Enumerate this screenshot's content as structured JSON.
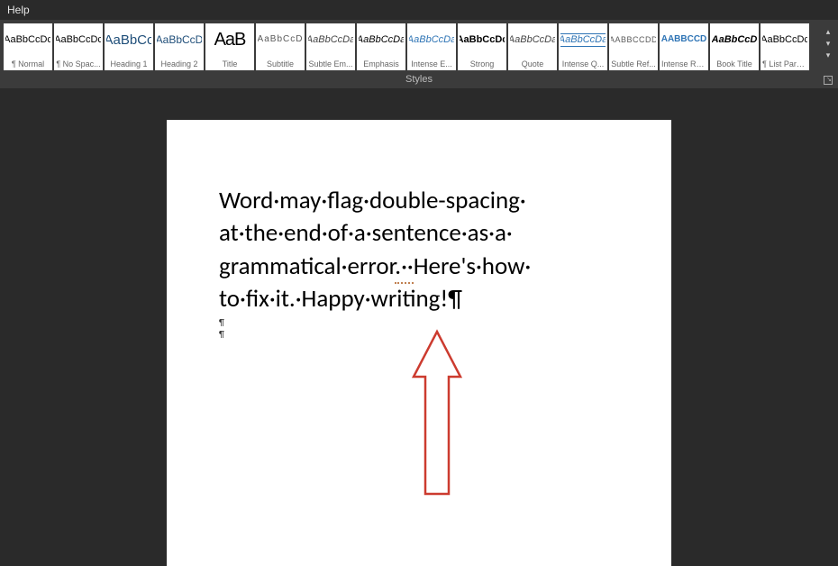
{
  "menu": {
    "help": "Help"
  },
  "styles": {
    "group_label": "Styles",
    "items": [
      {
        "sample": "AaBbCcDc",
        "label": "¶ Normal",
        "cls": "s-normal"
      },
      {
        "sample": "AaBbCcDc",
        "label": "¶ No Spac...",
        "cls": "s-normal"
      },
      {
        "sample": "AaBbCc",
        "label": "Heading 1",
        "cls": "s-heading1"
      },
      {
        "sample": "AaBbCcD",
        "label": "Heading 2",
        "cls": "s-heading2"
      },
      {
        "sample": "AaB",
        "label": "Title",
        "cls": "s-title"
      },
      {
        "sample": "AaBbCcD",
        "label": "Subtitle",
        "cls": "s-subtitle"
      },
      {
        "sample": "AaBbCcDa",
        "label": "Subtle Em...",
        "cls": "s-subtleem"
      },
      {
        "sample": "AaBbCcDa",
        "label": "Emphasis",
        "cls": "s-emphasis"
      },
      {
        "sample": "AaBbCcDa",
        "label": "Intense E...",
        "cls": "s-intensee"
      },
      {
        "sample": "AaBbCcDc",
        "label": "Strong",
        "cls": "s-strong"
      },
      {
        "sample": "AaBbCcDa",
        "label": "Quote",
        "cls": "s-quote"
      },
      {
        "sample": "AaBbCcDa",
        "label": "Intense Q...",
        "cls": "s-intenseq"
      },
      {
        "sample": "AABBCCDD",
        "label": "Subtle Ref...",
        "cls": "s-subtleref"
      },
      {
        "sample": "AABBCCD",
        "label": "Intense Re...",
        "cls": "s-intenseref"
      },
      {
        "sample": "AaBbCcD",
        "label": "Book Title",
        "cls": "s-booktitle"
      },
      {
        "sample": "AaBbCcDc",
        "label": "¶ List Para...",
        "cls": "s-listpara"
      }
    ]
  },
  "doc": {
    "line1": "Word·may·flag·double-spacing·",
    "line2": "at·the·end·of·a·sentence·as·a·",
    "line3a": "grammatical·error",
    "line3err": ".··",
    "line3b": "Here's·how·",
    "line4": "to·fix·it.·Happy·writing!¶",
    "p2": "¶",
    "p3": "¶"
  }
}
